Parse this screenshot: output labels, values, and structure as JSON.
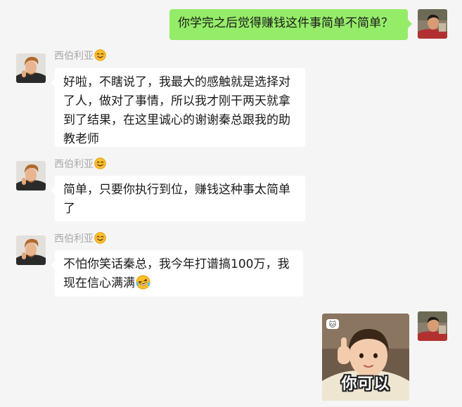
{
  "messages": [
    {
      "sender": "me",
      "type": "text",
      "text": "你学完之后觉得赚钱这件事简单不简单？"
    },
    {
      "sender": "西伯利亚",
      "type": "text",
      "text": "好啦，不瞎说了，我最大的感触就是选择对了人，做对了事情，所以我才刚干两天就拿到了结果，在这里诚心的谢谢秦总跟我的助教老师"
    },
    {
      "sender": "西伯利亚",
      "type": "text",
      "text": "简单，只要你执行到位，赚钱这种事太简单了"
    },
    {
      "sender": "西伯利亚",
      "type": "text",
      "text": "不怕你笑话秦总，我今年打谱搞100万，我现在信心满满",
      "trailing_emoji": "laughing-crying-emoji"
    },
    {
      "sender": "me",
      "type": "sticker",
      "caption": "你可以",
      "badge": "cat-emoji-icon"
    }
  ],
  "contact": {
    "display_name": "西伯利亚",
    "name_emoji": "smiling-face-emoji"
  },
  "colors": {
    "background": "#f5f5f5",
    "my_bubble": "#95ec69",
    "their_bubble": "#ffffff",
    "name_text": "#a8a8a8"
  }
}
